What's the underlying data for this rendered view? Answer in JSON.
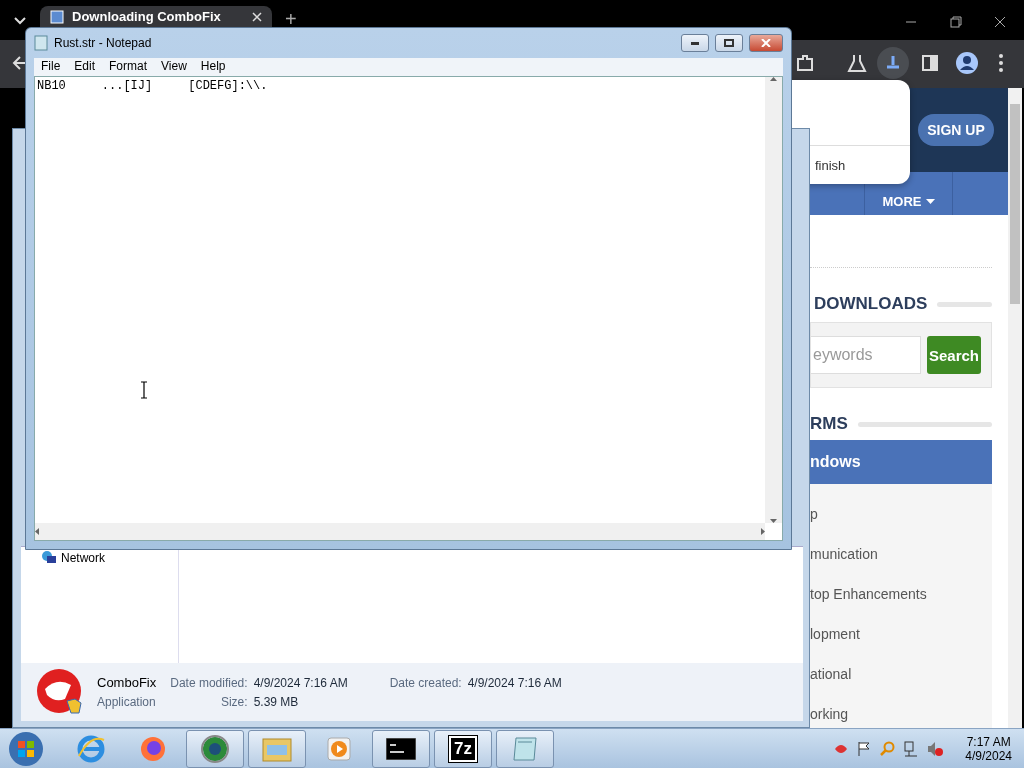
{
  "browser": {
    "tabs": [
      {
        "title": "Downloading ComboFix",
        "selected": true
      }
    ],
    "new_tab": "+"
  },
  "download_bubble": {
    "text": "finish"
  },
  "website": {
    "signup": "SIGN UP",
    "nav_more": "MORE",
    "downloads_heading": "DOWNLOADS",
    "search": {
      "placeholder": "eywords",
      "button": "Search"
    },
    "platforms_heading": "RMS",
    "active_platform": "ndows",
    "categories": [
      "p",
      "munication",
      "top Enhancements",
      "lopment",
      "ational",
      "orking"
    ]
  },
  "notepad": {
    "title": "Rust.str - Notepad",
    "menu": [
      "File",
      "Edit",
      "Format",
      "View",
      "Help"
    ],
    "content": "NB10     ...[IJ]     [CDEFG]:\\\\."
  },
  "explorer": {
    "nav_items": [
      "Network"
    ],
    "details": {
      "name": "ComboFix",
      "type": "Application",
      "fields": [
        {
          "label": "Date modified:",
          "value": "4/9/2024 7:16 AM"
        },
        {
          "label": "Date created:",
          "value": "4/9/2024 7:16 AM"
        },
        {
          "label": "Size:",
          "value": "5.39 MB"
        }
      ]
    }
  },
  "taskbar": {
    "apps": [
      {
        "kind": "ie",
        "running": false
      },
      {
        "kind": "firefox",
        "running": false
      },
      {
        "kind": "globe",
        "running": true
      },
      {
        "kind": "folder",
        "running": true
      },
      {
        "kind": "media",
        "running": false
      },
      {
        "kind": "console",
        "running": true
      },
      {
        "kind": "archiver",
        "label": "7z",
        "running": true
      },
      {
        "kind": "notepad",
        "running": true
      }
    ],
    "clock_time": "7:17 AM",
    "clock_date": "4/9/2024"
  }
}
